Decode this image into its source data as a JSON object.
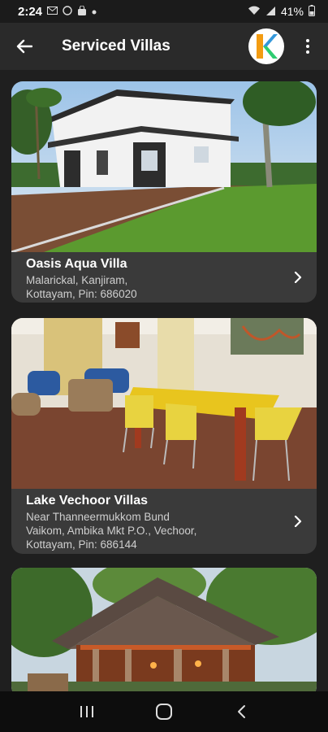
{
  "status_bar": {
    "time": "2:24",
    "battery": "41%",
    "icons": [
      "mail-icon",
      "whatsapp-icon",
      "bag-icon",
      "dot-icon",
      "wifi-icon",
      "signal-icon",
      "battery-icon"
    ]
  },
  "app_bar": {
    "title": "Serviced Villas",
    "back_icon": "arrow-back-icon",
    "logo_letter": "K",
    "more_icon": "more-vert-icon"
  },
  "villas": [
    {
      "name": "Oasis Aqua Villa",
      "address": "Malarickal, Kanjiram,\nKottayam, Pin: 686020"
    },
    {
      "name": "Lake Vechoor Villas",
      "address": "Near Thanneermukkom Bund\nVaikom, Ambika Mkt P.O., Vechoor,\nKottayam, Pin: 686144"
    },
    {
      "name": "",
      "address": ""
    }
  ],
  "colors": {
    "background": "#1f1f1f",
    "card": "#3a3a3a",
    "app_bar": "#2a2a2a",
    "logo_orange": "#f39c12",
    "logo_green": "#2ecc71",
    "logo_blue": "#3498db"
  }
}
